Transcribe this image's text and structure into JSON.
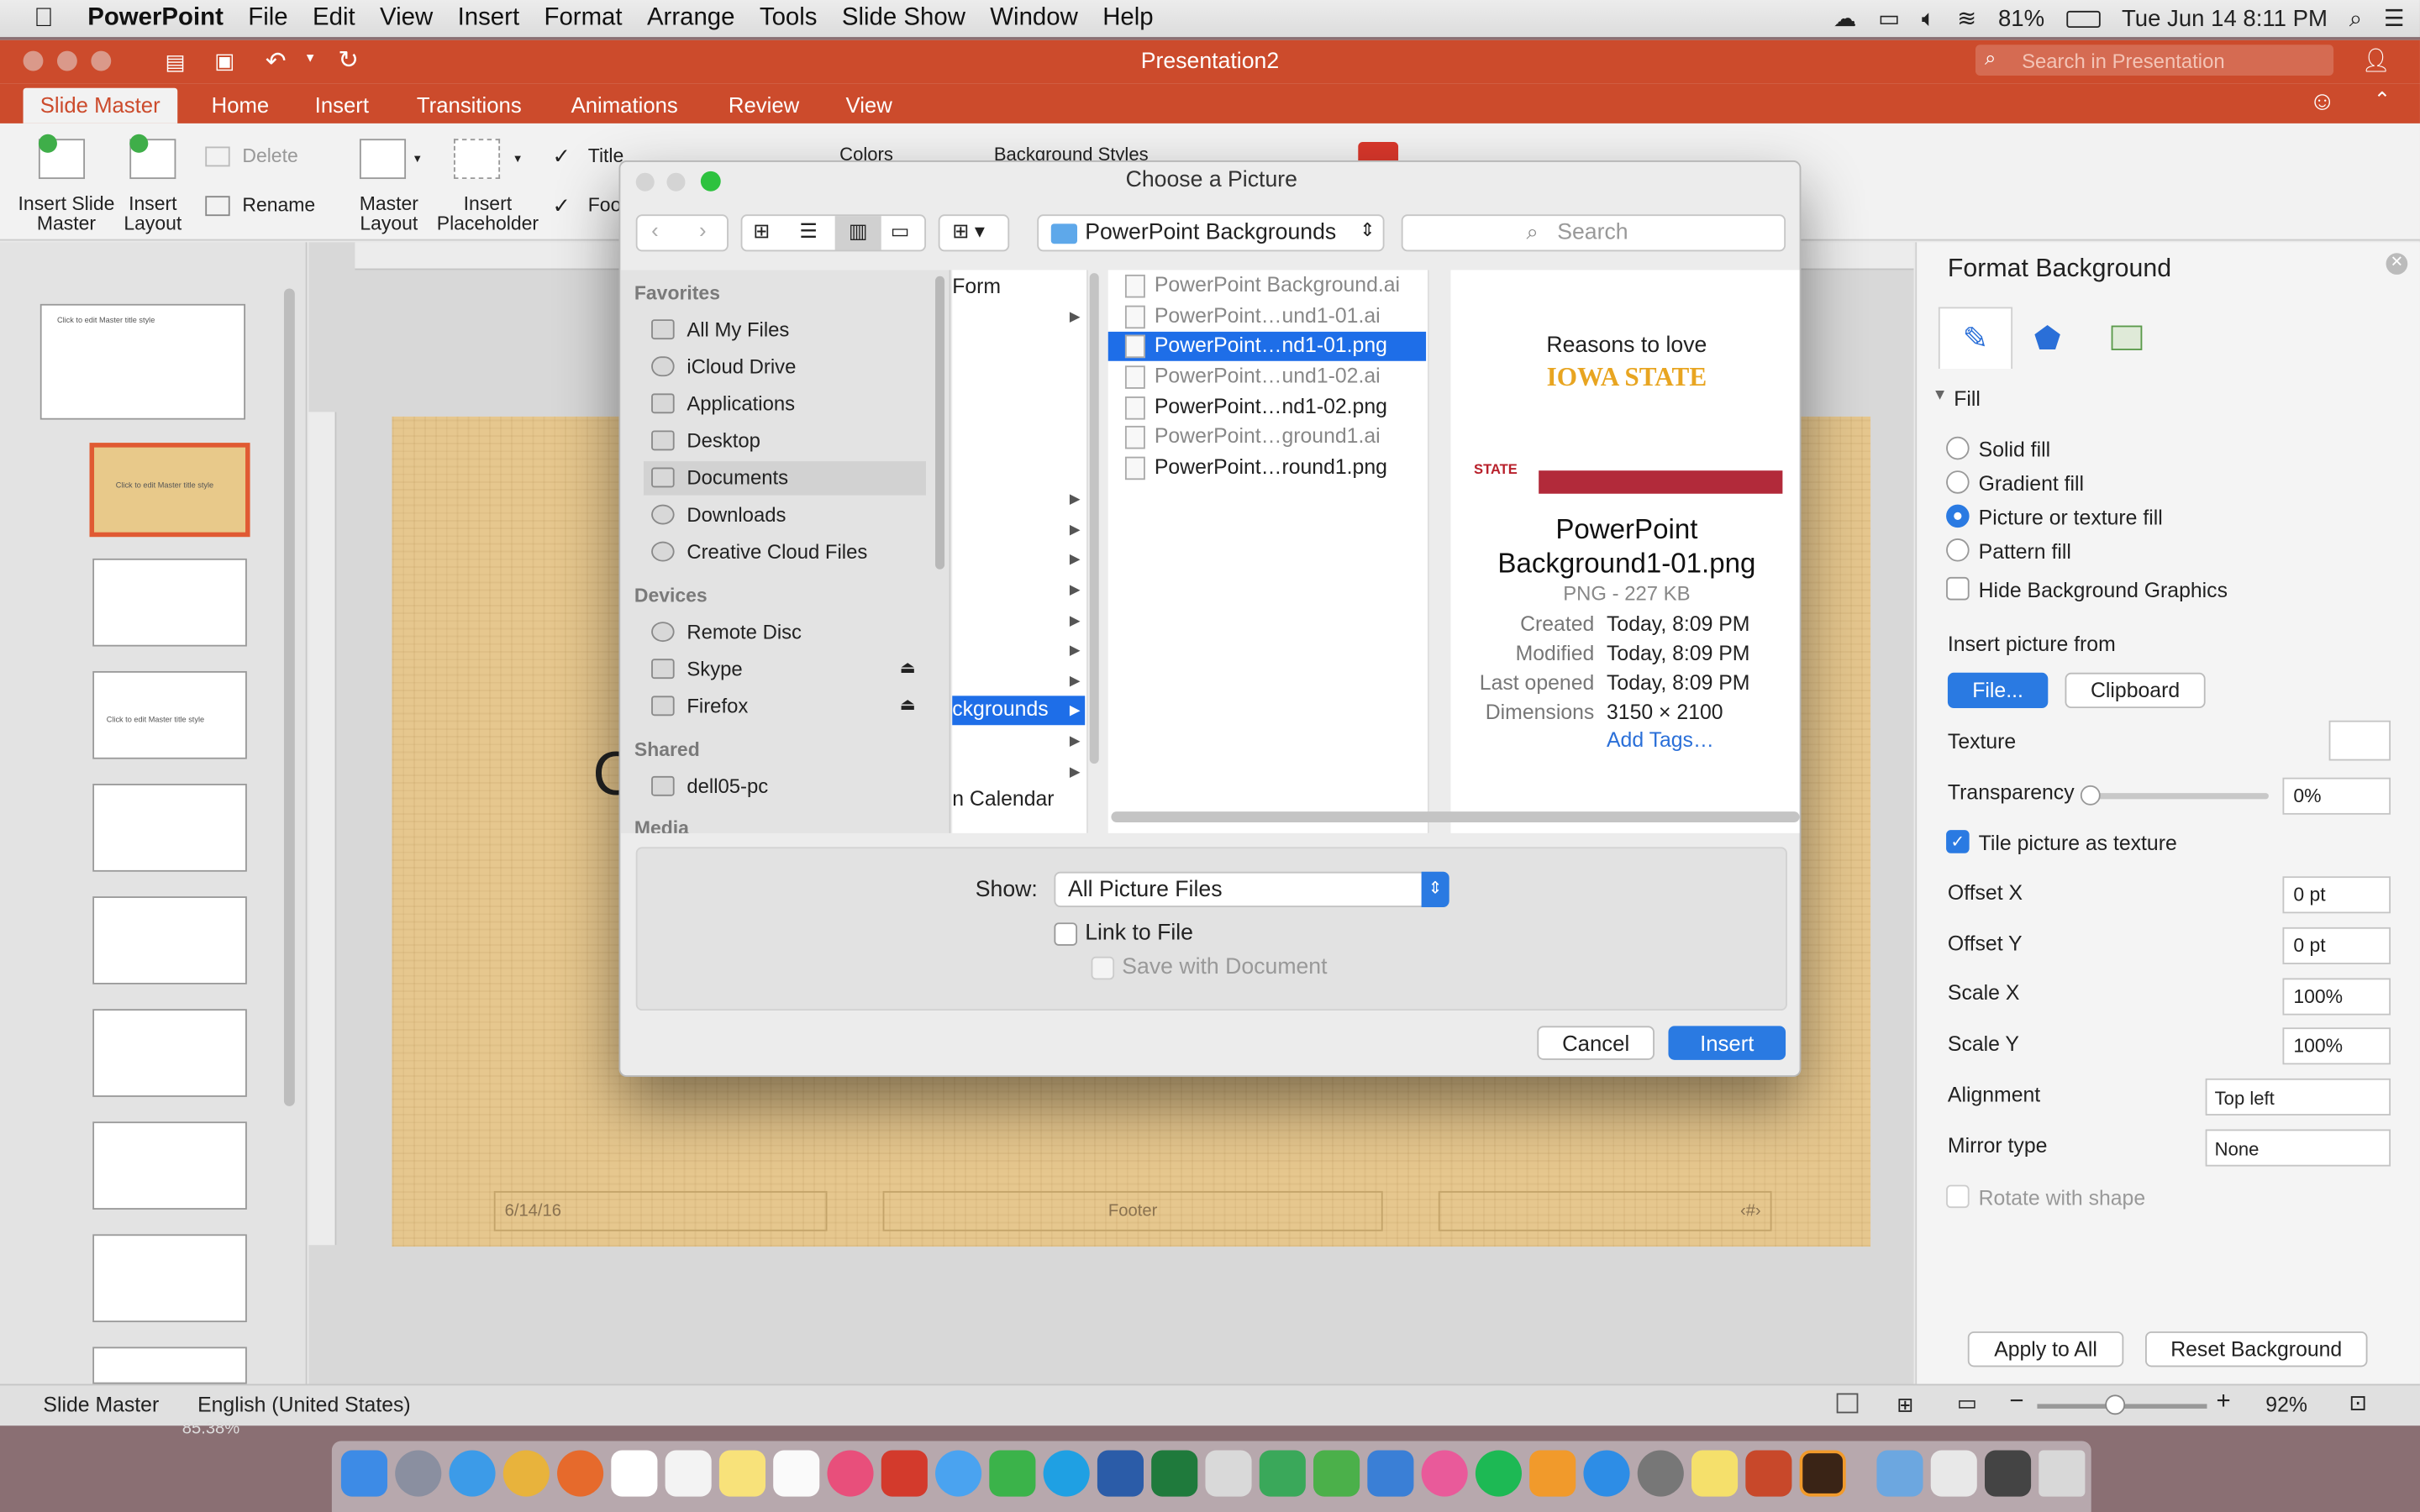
{
  "menubar": {
    "app": "PowerPoint",
    "items": [
      "File",
      "Edit",
      "View",
      "Insert",
      "Format",
      "Arrange",
      "Tools",
      "Slide Show",
      "Window",
      "Help"
    ],
    "battery": "81%",
    "clock": "Tue Jun 14  8:11 PM"
  },
  "window": {
    "title": "Presentation2",
    "search_placeholder": "Search in Presentation"
  },
  "tabs": [
    "Slide Master",
    "Home",
    "Insert",
    "Transitions",
    "Animations",
    "Review",
    "View"
  ],
  "ribbon": {
    "insert_slide_master": "Insert Slide Master",
    "insert_layout": "Insert Layout",
    "delete": "Delete",
    "rename": "Rename",
    "master_layout": "Master Layout",
    "insert_placeholder": "Insert Placeholder",
    "title": "Title",
    "footers": "Foo",
    "colors": "Colors",
    "background_styles": "Background Styles"
  },
  "thumbs": {
    "master_title": "Click to edit Master title style"
  },
  "slide": {
    "date": "6/14/16",
    "footer": "Footer",
    "number": "‹#›",
    "partial": "C"
  },
  "format_pane": {
    "title": "Format Background",
    "section": "Fill",
    "fill_options": [
      "Solid fill",
      "Gradient fill",
      "Picture or texture fill",
      "Pattern fill"
    ],
    "hide_bg": "Hide Background Graphics",
    "insert_from": "Insert picture from",
    "file_btn": "File...",
    "clipboard_btn": "Clipboard",
    "texture": "Texture",
    "transparency": "Transparency",
    "transparency_value": "0%",
    "tile": "Tile picture as texture",
    "offset_x": "Offset X",
    "offset_x_value": "0 pt",
    "offset_y": "Offset Y",
    "offset_y_value": "0 pt",
    "scale_x": "Scale X",
    "scale_x_value": "100%",
    "scale_y": "Scale Y",
    "scale_y_value": "100%",
    "alignment": "Alignment",
    "alignment_value": "Top left",
    "mirror": "Mirror type",
    "mirror_value": "None",
    "rotate": "Rotate with shape",
    "apply_all": "Apply to All",
    "reset": "Reset Background"
  },
  "status": {
    "view": "Slide Master",
    "language": "English (United States)",
    "zoom": "92%",
    "bg_pct": "85.38%"
  },
  "dialog": {
    "title": "Choose a Picture",
    "location": "PowerPoint Backgrounds",
    "search_placeholder": "Search",
    "favorites_label": "Favorites",
    "favorites": [
      "All My Files",
      "iCloud Drive",
      "Applications",
      "Desktop",
      "Documents",
      "Downloads",
      "Creative Cloud Files"
    ],
    "devices_label": "Devices",
    "devices": [
      "Remote Disc",
      "Skype",
      "Firefox"
    ],
    "shared_label": "Shared",
    "shared": [
      "dell05-pc"
    ],
    "media_label": "Media",
    "col1": {
      "top": "Form",
      "selected": "ckgrounds",
      "bottom": "n Calendar"
    },
    "files": [
      "PowerPoint Background.ai",
      "PowerPoint…und1-01.ai",
      "PowerPoint…nd1-01.png",
      "PowerPoint…und1-02.ai",
      "PowerPoint…nd1-02.png",
      "PowerPoint…ground1.ai",
      "PowerPoint…round1.png"
    ],
    "preview": {
      "line1": "Reasons to love",
      "line2": "IOWA STATE",
      "logo": "STATE",
      "name": "PowerPoint Background1-01.png",
      "kind": "PNG - 227 KB",
      "created_label": "Created",
      "created": "Today, 8:09 PM",
      "modified_label": "Modified",
      "modified": "Today, 8:09 PM",
      "opened_label": "Last opened",
      "opened": "Today, 8:09 PM",
      "dims_label": "Dimensions",
      "dims": "3150 × 2100",
      "tags": "Add Tags…"
    },
    "show_label": "Show:",
    "show_value": "All Picture Files",
    "link": "Link to File",
    "save_with": "Save with Document",
    "cancel": "Cancel",
    "insert": "Insert"
  }
}
